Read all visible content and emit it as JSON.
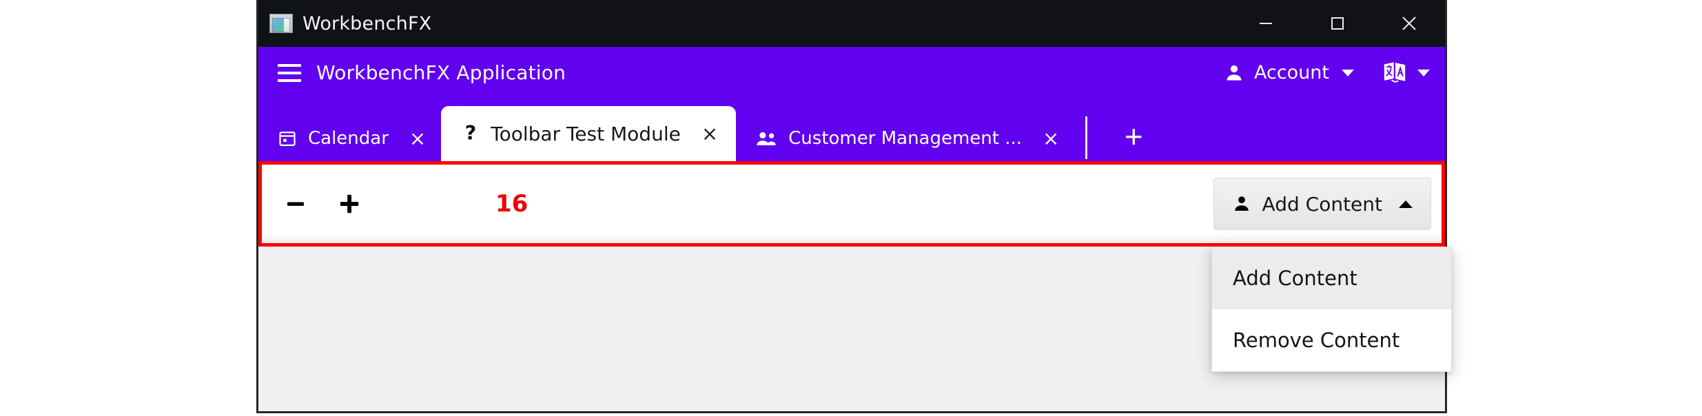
{
  "window": {
    "titlebar": {
      "app_icon": "app-window-chart-icon",
      "title": "WorkbenchFX",
      "controls": [
        {
          "name": "minimize",
          "glyph": "minimize-icon"
        },
        {
          "name": "maximize",
          "glyph": "maximize-icon"
        },
        {
          "name": "close",
          "glyph": "close-icon"
        }
      ]
    },
    "header": {
      "menu_icon": "hamburger-menu-icon",
      "title": "WorkbenchFX Application",
      "account": {
        "icon": "person-icon",
        "label": "Account",
        "caret": "chevron-down-icon"
      },
      "language": {
        "icon": "translate-icon",
        "caret": "chevron-down-icon"
      },
      "background_color": "#6200f0"
    },
    "tabs": [
      {
        "icon": "calendar-icon",
        "label": "Calendar",
        "close": "×",
        "active": false
      },
      {
        "icon": "question-mark-icon",
        "label": "Toolbar Test Module",
        "close": "×",
        "active": true
      },
      {
        "icon": "people-icon",
        "label": "Customer Management ...",
        "close": "×",
        "active": false
      }
    ],
    "add_tab": {
      "icon": "plus-icon",
      "label": "+"
    },
    "toolbar": {
      "minus_button": {
        "icon": "minus-icon",
        "label": "−"
      },
      "plus_button": {
        "icon": "plus-icon",
        "label": "+"
      },
      "counter_value": "16",
      "counter_color": "#f00000",
      "add_content_button": {
        "icon": "person-icon",
        "label": "Add Content",
        "caret": "chevron-up-icon",
        "expanded": true
      }
    },
    "dropdown": {
      "items": [
        {
          "label": "Add Content",
          "hovered": true
        },
        {
          "label": "Remove Content",
          "hovered": false
        }
      ]
    },
    "content_area": {
      "background_color": "#f0f0f0"
    }
  },
  "annotation": {
    "name": "toolbar-highlight-box",
    "color": "#ff0000"
  }
}
